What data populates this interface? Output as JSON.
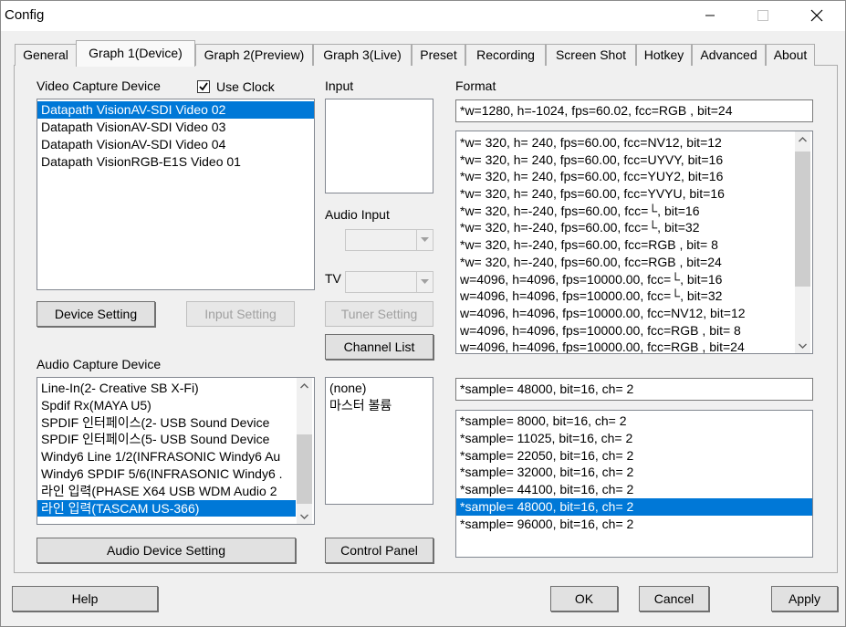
{
  "window": {
    "title": "Config"
  },
  "tabs": [
    {
      "label": "General"
    },
    {
      "label": "Graph 1(Device)"
    },
    {
      "label": "Graph 2(Preview)"
    },
    {
      "label": "Graph 3(Live)"
    },
    {
      "label": "Preset"
    },
    {
      "label": "Recording"
    },
    {
      "label": "Screen Shot"
    },
    {
      "label": "Hotkey"
    },
    {
      "label": "Advanced"
    },
    {
      "label": "About"
    }
  ],
  "active_tab": "Graph 1(Device)",
  "video": {
    "label": "Video Capture Device",
    "use_clock_label": "Use Clock",
    "use_clock_checked": true,
    "devices": [
      "Datapath VisionAV-SDI Video 02",
      "Datapath VisionAV-SDI Video 03",
      "Datapath VisionAV-SDI Video 04",
      "Datapath VisionRGB-E1S Video 01"
    ],
    "selected_device": "Datapath VisionAV-SDI Video 02",
    "device_setting_label": "Device Setting",
    "input_setting_label": "Input Setting"
  },
  "input": {
    "label": "Input",
    "audio_input_label": "Audio Input",
    "tv_label": "TV",
    "tuner_setting_label": "Tuner Setting",
    "channel_list_label": "Channel List"
  },
  "format": {
    "label": "Format",
    "current": "*w=1280, h=-1024, fps=60.02,  fcc=RGB , bit=24",
    "items": [
      "*w= 320, h= 240, fps=60.00,  fcc=NV12, bit=12",
      "*w= 320, h= 240, fps=60.00,  fcc=UYVY, bit=16",
      "*w= 320, h= 240, fps=60.00,  fcc=YUY2, bit=16",
      "*w= 320, h= 240, fps=60.00,  fcc=YVYU, bit=16",
      "*w= 320, h=-240, fps=60.00,  fcc=└, bit=16",
      "*w= 320, h=-240, fps=60.00,  fcc=└, bit=32",
      "*w= 320, h=-240, fps=60.00,  fcc=RGB , bit= 8",
      "*w= 320, h=-240, fps=60.00,  fcc=RGB , bit=24",
      "w=4096, h=4096, fps=10000.00,  fcc=└, bit=16",
      "w=4096, h=4096, fps=10000.00,  fcc=└, bit=32",
      "w=4096, h=4096, fps=10000.00,  fcc=NV12, bit=12",
      "w=4096, h=4096, fps=10000.00,  fcc=RGB , bit= 8",
      "w=4096, h=4096, fps=10000.00,  fcc=RGB , bit=24"
    ]
  },
  "audio": {
    "label": "Audio Capture Device",
    "devices": [
      "Line-In(2- Creative SB X-Fi)",
      "Spdif Rx(MAYA U5)",
      "SPDIF 인터페이스(2- USB Sound Device",
      "SPDIF 인터페이스(5- USB Sound Device",
      "Windy6 Line 1/2(INFRASONIC Windy6 Au",
      "Windy6 SPDIF 5/6(INFRASONIC Windy6 .",
      "라인 입력(PHASE X64 USB WDM Audio 2",
      "라인 입력(TASCAM US-366)"
    ],
    "selected_device": "라인 입력(TASCAM US-366)",
    "audio_device_setting_label": "Audio Device Setting",
    "inputs": [
      "(none)",
      "마스터 볼륨"
    ],
    "control_panel_label": "Control Panel",
    "sample_current": "*sample= 48000, bit=16, ch= 2",
    "samples": [
      "*sample=  8000, bit=16, ch= 2",
      "*sample= 11025, bit=16, ch= 2",
      "*sample= 22050, bit=16, ch= 2",
      "*sample= 32000, bit=16, ch= 2",
      "*sample= 44100, bit=16, ch= 2",
      "*sample= 48000, bit=16, ch= 2",
      "*sample= 96000, bit=16, ch= 2"
    ],
    "selected_sample": "*sample= 48000, bit=16, ch= 2"
  },
  "footer": {
    "help_label": "Help",
    "ok_label": "OK",
    "cancel_label": "Cancel",
    "apply_label": "Apply"
  },
  "colors": {
    "selection": "#0078d7",
    "window_bg": "#f0f0f0"
  },
  "icons": [
    "minimize-icon",
    "maximize-icon",
    "close-icon",
    "checkmark-icon",
    "chevron-up-icon",
    "chevron-down-icon"
  ]
}
